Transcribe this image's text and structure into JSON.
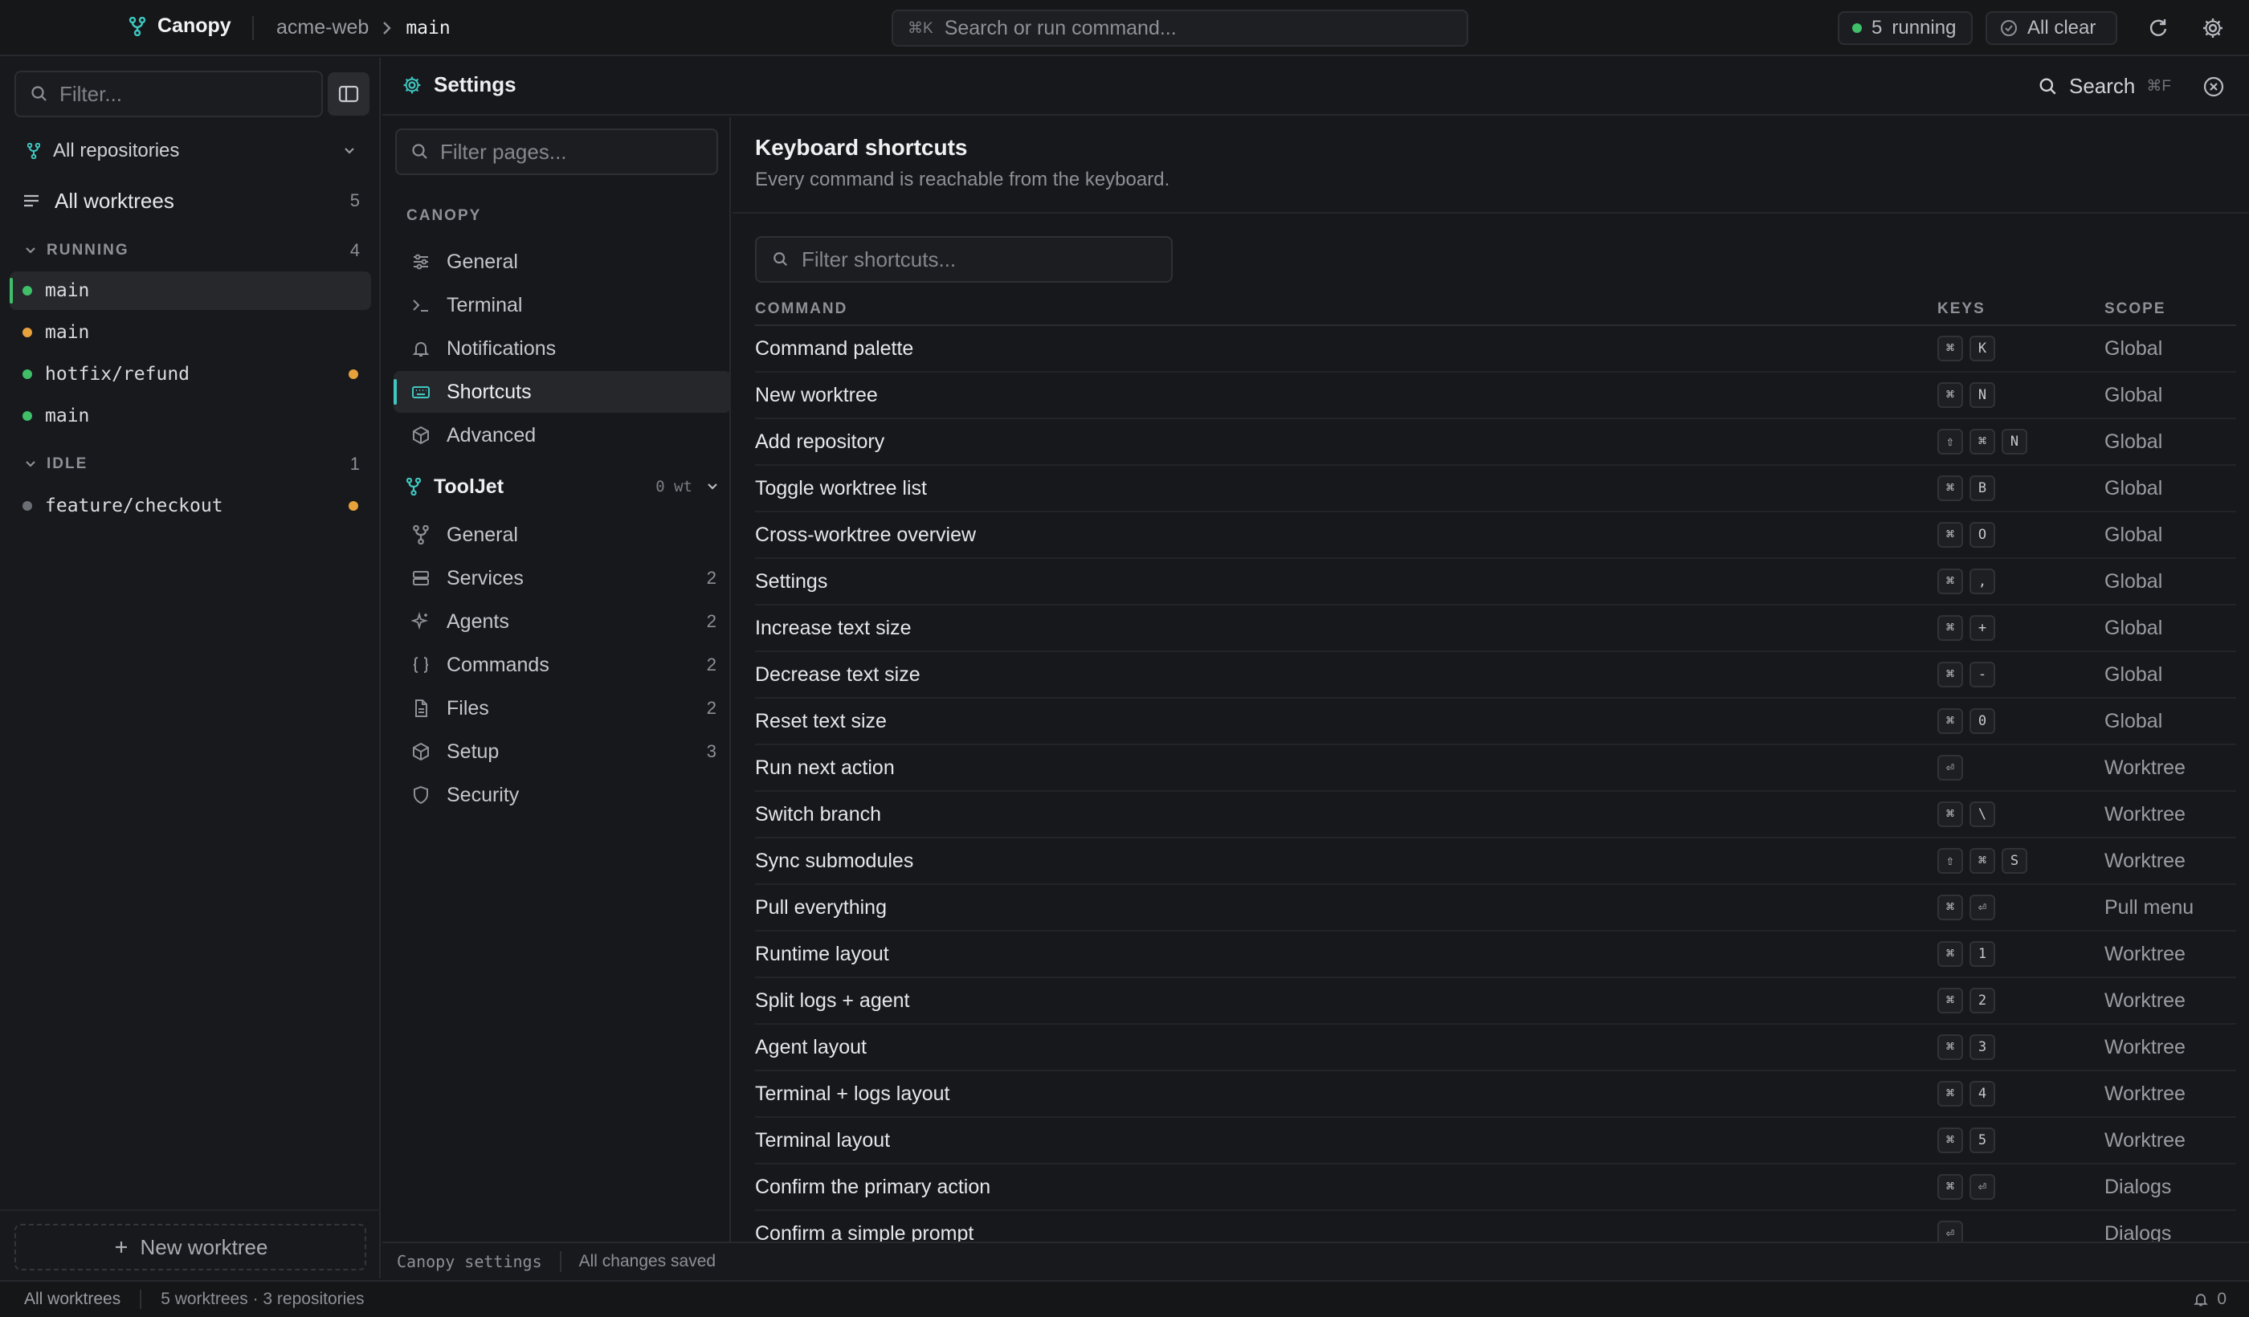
{
  "colors": {
    "accent": "#3fc7c0",
    "running": "#3fbf68",
    "dirty": "#e8a23c",
    "background": "#17181b"
  },
  "titlebar": {
    "app_name": "Canopy",
    "breadcrumb_repo": "acme-web",
    "breadcrumb_branch": "main",
    "command_kbd": "⌘K",
    "command_placeholder": "Search or run command...",
    "running_count": "5",
    "running_label": "running",
    "status_label": "All clear",
    "icons": [
      "canopy-logo-icon",
      "chevron-right-icon",
      "refresh-icon",
      "gear-icon"
    ]
  },
  "sidebar": {
    "filter_placeholder": "Filter...",
    "repo_select": "All repositories",
    "all_worktrees_label": "All worktrees",
    "all_worktrees_count": "5",
    "groups": [
      {
        "label": "RUNNING",
        "count": "4",
        "items": [
          {
            "name": "main",
            "status": "running",
            "dirty": false,
            "active": true
          },
          {
            "name": "main",
            "status": "dirty",
            "dirty": false,
            "active": false
          },
          {
            "name": "hotfix/refund",
            "status": "running",
            "dirty": true,
            "active": false
          },
          {
            "name": "main",
            "status": "running",
            "dirty": false,
            "active": false
          }
        ]
      },
      {
        "label": "IDLE",
        "count": "1",
        "items": [
          {
            "name": "feature/checkout",
            "status": "idle",
            "dirty": true,
            "active": false
          }
        ]
      }
    ],
    "new_worktree_label": "New worktree"
  },
  "settings": {
    "title": "Settings",
    "search_label": "Search",
    "search_kbd": "⌘F",
    "pages_filter_placeholder": "Filter pages...",
    "canopy_section": "CANOPY",
    "canopy_items": [
      {
        "label": "General",
        "icon": "sliders-icon"
      },
      {
        "label": "Terminal",
        "icon": "terminal-icon"
      },
      {
        "label": "Notifications",
        "icon": "bell-icon"
      },
      {
        "label": "Shortcuts",
        "icon": "keyboard-icon",
        "active": true
      },
      {
        "label": "Advanced",
        "icon": "cube-icon"
      }
    ],
    "project_name": "ToolJet",
    "project_wt": "0 wt",
    "project_items": [
      {
        "label": "General",
        "icon": "branch-icon",
        "count": ""
      },
      {
        "label": "Services",
        "icon": "server-icon",
        "count": "2"
      },
      {
        "label": "Agents",
        "icon": "sparkle-icon",
        "count": "2"
      },
      {
        "label": "Commands",
        "icon": "braces-icon",
        "count": "2"
      },
      {
        "label": "Files",
        "icon": "file-icon",
        "count": "2"
      },
      {
        "label": "Setup",
        "icon": "cube-icon",
        "count": "3"
      },
      {
        "label": "Security",
        "icon": "shield-icon",
        "count": ""
      }
    ],
    "footer_name": "Canopy settings",
    "footer_status": "All changes saved"
  },
  "shortcuts": {
    "title": "Keyboard shortcuts",
    "subtitle": "Every command is reachable from the keyboard.",
    "filter_placeholder": "Filter shortcuts...",
    "columns": [
      "COMMAND",
      "KEYS",
      "SCOPE"
    ],
    "rows": [
      {
        "command": "Command palette",
        "keys": [
          "⌘",
          "K"
        ],
        "scope": "Global"
      },
      {
        "command": "New worktree",
        "keys": [
          "⌘",
          "N"
        ],
        "scope": "Global"
      },
      {
        "command": "Add repository",
        "keys": [
          "⇧",
          "⌘",
          "N"
        ],
        "scope": "Global"
      },
      {
        "command": "Toggle worktree list",
        "keys": [
          "⌘",
          "B"
        ],
        "scope": "Global"
      },
      {
        "command": "Cross-worktree overview",
        "keys": [
          "⌘",
          "O"
        ],
        "scope": "Global"
      },
      {
        "command": "Settings",
        "keys": [
          "⌘",
          ","
        ],
        "scope": "Global"
      },
      {
        "command": "Increase text size",
        "keys": [
          "⌘",
          "+"
        ],
        "scope": "Global"
      },
      {
        "command": "Decrease text size",
        "keys": [
          "⌘",
          "-"
        ],
        "scope": "Global"
      },
      {
        "command": "Reset text size",
        "keys": [
          "⌘",
          "0"
        ],
        "scope": "Global"
      },
      {
        "command": "Run next action",
        "keys": [
          "⏎"
        ],
        "scope": "Worktree"
      },
      {
        "command": "Switch branch",
        "keys": [
          "⌘",
          "\\"
        ],
        "scope": "Worktree"
      },
      {
        "command": "Sync submodules",
        "keys": [
          "⇧",
          "⌘",
          "S"
        ],
        "scope": "Worktree"
      },
      {
        "command": "Pull everything",
        "keys": [
          "⌘",
          "⏎"
        ],
        "scope": "Pull menu"
      },
      {
        "command": "Runtime layout",
        "keys": [
          "⌘",
          "1"
        ],
        "scope": "Worktree"
      },
      {
        "command": "Split logs + agent",
        "keys": [
          "⌘",
          "2"
        ],
        "scope": "Worktree"
      },
      {
        "command": "Agent layout",
        "keys": [
          "⌘",
          "3"
        ],
        "scope": "Worktree"
      },
      {
        "command": "Terminal + logs layout",
        "keys": [
          "⌘",
          "4"
        ],
        "scope": "Worktree"
      },
      {
        "command": "Terminal layout",
        "keys": [
          "⌘",
          "5"
        ],
        "scope": "Worktree"
      },
      {
        "command": "Confirm the primary action",
        "keys": [
          "⌘",
          "⏎"
        ],
        "scope": "Dialogs"
      },
      {
        "command": "Confirm a simple prompt",
        "keys": [
          "⏎"
        ],
        "scope": "Dialogs"
      }
    ]
  },
  "statusbar": {
    "left_label": "All worktrees",
    "summary": "5 worktrees · 3 repositories",
    "notifications_count": "0"
  }
}
